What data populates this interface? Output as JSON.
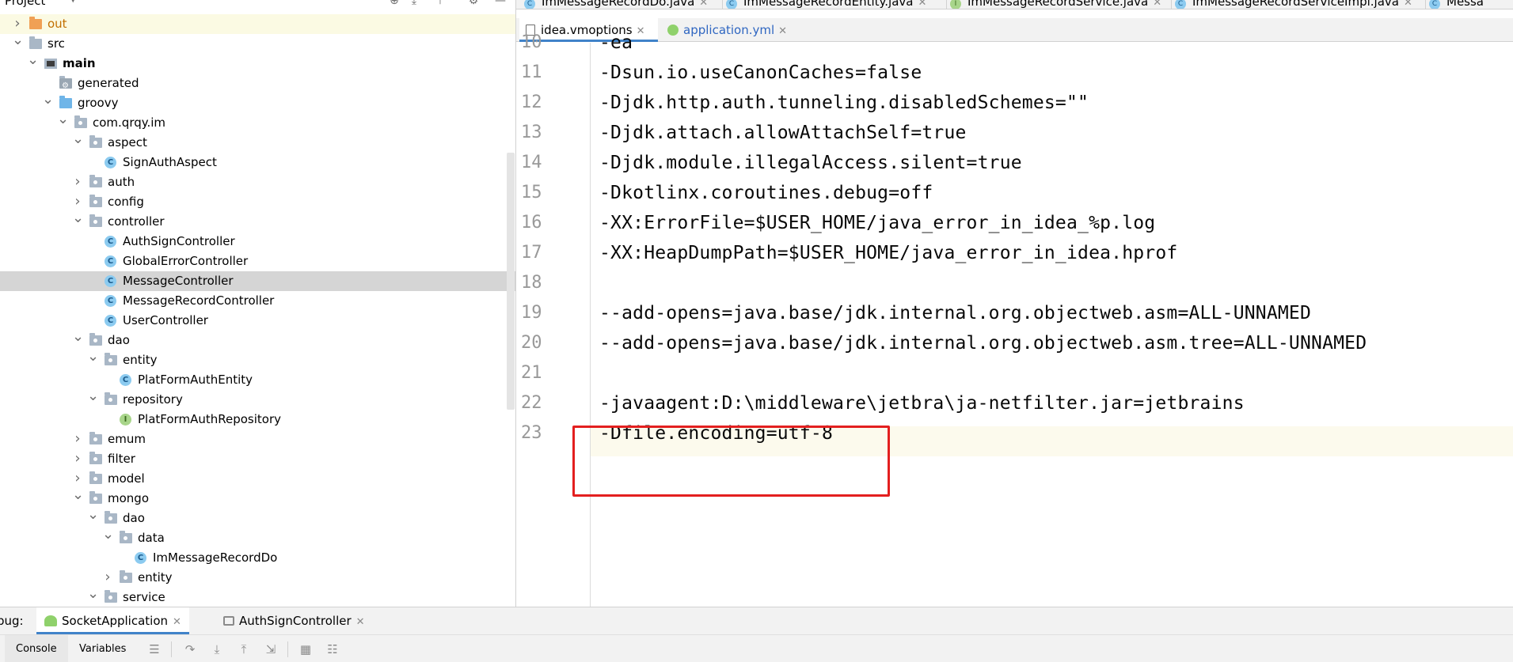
{
  "project_panel": {
    "title": "Project",
    "tree": [
      {
        "label": "out",
        "type": "folder-orange",
        "state": "closed",
        "excluded": true
      },
      {
        "label": "src",
        "type": "folder",
        "state": "open"
      },
      {
        "label": "main",
        "type": "main",
        "state": "open",
        "bold": true
      },
      {
        "label": "generated",
        "type": "generated",
        "state": "none"
      },
      {
        "label": "groovy",
        "type": "folder-blue",
        "state": "open"
      },
      {
        "label": "com.qrqy.im",
        "type": "package",
        "state": "open"
      },
      {
        "label": "aspect",
        "type": "package",
        "state": "open"
      },
      {
        "label": "SignAuthAspect",
        "type": "class",
        "state": "none"
      },
      {
        "label": "auth",
        "type": "package",
        "state": "closed"
      },
      {
        "label": "config",
        "type": "package",
        "state": "closed"
      },
      {
        "label": "controller",
        "type": "package",
        "state": "open"
      },
      {
        "label": "AuthSignController",
        "type": "class",
        "state": "none"
      },
      {
        "label": "GlobalErrorController",
        "type": "class",
        "state": "none"
      },
      {
        "label": "MessageController",
        "type": "class",
        "state": "none",
        "selected": true
      },
      {
        "label": "MessageRecordController",
        "type": "class",
        "state": "none"
      },
      {
        "label": "UserController",
        "type": "class",
        "state": "none"
      },
      {
        "label": "dao",
        "type": "package",
        "state": "open"
      },
      {
        "label": "entity",
        "type": "package",
        "state": "open"
      },
      {
        "label": "PlatFormAuthEntity",
        "type": "class",
        "state": "none"
      },
      {
        "label": "repository",
        "type": "package",
        "state": "open"
      },
      {
        "label": "PlatFormAuthRepository",
        "type": "interface",
        "state": "none"
      },
      {
        "label": "emum",
        "type": "package",
        "state": "closed"
      },
      {
        "label": "filter",
        "type": "package",
        "state": "closed"
      },
      {
        "label": "model",
        "type": "package",
        "state": "closed"
      },
      {
        "label": "mongo",
        "type": "package",
        "state": "open"
      },
      {
        "label": "dao",
        "type": "package",
        "state": "open"
      },
      {
        "label": "data",
        "type": "package",
        "state": "open"
      },
      {
        "label": "ImMessageRecordDo",
        "type": "class",
        "state": "none"
      },
      {
        "label": "entity",
        "type": "package",
        "state": "closed"
      },
      {
        "label": "service",
        "type": "package",
        "state": "open"
      }
    ]
  },
  "editor_tabs_top": [
    {
      "label": "ImMessageRecordDo.java",
      "icon": "class"
    },
    {
      "label": "ImMessageRecordEntity.java",
      "icon": "class"
    },
    {
      "label": "ImMessageRecordService.java",
      "icon": "interface"
    },
    {
      "label": "ImMessageRecordServiceImpl.java",
      "icon": "class"
    },
    {
      "label": "Messa",
      "icon": "class"
    }
  ],
  "editor_tabs": [
    {
      "label": "idea.vmoptions",
      "active": true
    },
    {
      "label": "application.yml",
      "active": false
    }
  ],
  "editor": {
    "lines": [
      {
        "no": "10",
        "text": "-ea"
      },
      {
        "no": "11",
        "text": "-Dsun.io.useCanonCaches=false"
      },
      {
        "no": "12",
        "text": "-Djdk.http.auth.tunneling.disabledSchemes=\"\""
      },
      {
        "no": "13",
        "text": "-Djdk.attach.allowAttachSelf=true"
      },
      {
        "no": "14",
        "text": "-Djdk.module.illegalAccess.silent=true"
      },
      {
        "no": "15",
        "text": "-Dkotlinx.coroutines.debug=off"
      },
      {
        "no": "16",
        "text": "-XX:ErrorFile=$USER_HOME/java_error_in_idea_%p.log"
      },
      {
        "no": "17",
        "text": "-XX:HeapDumpPath=$USER_HOME/java_error_in_idea.hprof"
      },
      {
        "no": "18",
        "text": ""
      },
      {
        "no": "19",
        "text": "--add-opens=java.base/jdk.internal.org.objectweb.asm=ALL-UNNAMED"
      },
      {
        "no": "20",
        "text": "--add-opens=java.base/jdk.internal.org.objectweb.asm.tree=ALL-UNNAMED"
      },
      {
        "no": "21",
        "text": ""
      },
      {
        "no": "22",
        "text": "-javaagent:D:\\middleware\\jetbra\\ja-netfilter.jar=jetbrains"
      },
      {
        "no": "23",
        "text": "-Dfile.encoding=utf-8"
      }
    ]
  },
  "debug": {
    "prefix": "bug:",
    "tabs": [
      {
        "label": "SocketApplication",
        "active": true
      },
      {
        "label": "AuthSignController",
        "active": false
      }
    ],
    "console_label": "Console",
    "variables_label": "Variables"
  },
  "colors": {
    "accent": "#4083c9",
    "highlight_box": "#e31f1f",
    "selection": "#d5d5d5"
  }
}
